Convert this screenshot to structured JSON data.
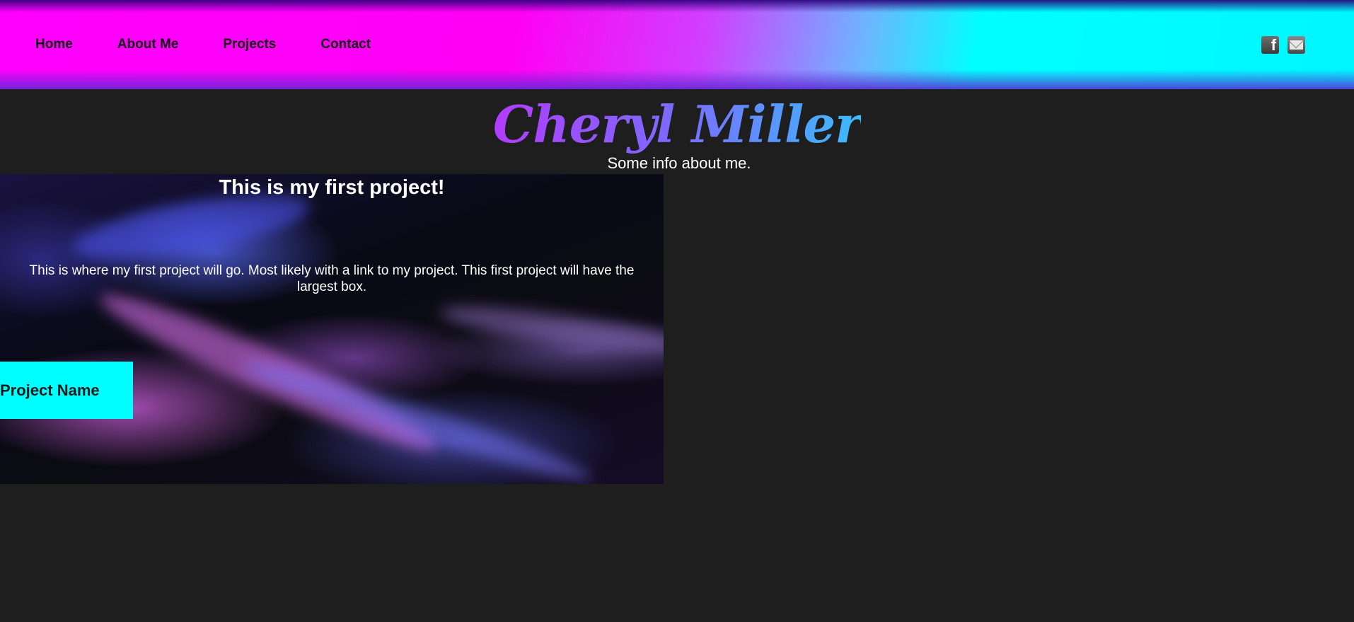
{
  "header": {
    "nav": [
      {
        "label": "Home"
      },
      {
        "label": "About Me"
      },
      {
        "label": "Projects"
      },
      {
        "label": "Contact"
      }
    ],
    "social": [
      {
        "icon": "facebook-icon",
        "glyph": "f"
      },
      {
        "icon": "email-icon"
      }
    ]
  },
  "hero": {
    "title": "Cheryl Miller",
    "subtitle": "Some info about me."
  },
  "project": {
    "title": "This is my first project!",
    "description": "This is where my first project will go. Most likely with a link to my project. This first project will have the largest box.",
    "name_button": "Project Name"
  },
  "colors": {
    "page_background": "#1e1e1e",
    "accent_cyan": "#00ffff",
    "accent_magenta": "#ff00ff"
  }
}
